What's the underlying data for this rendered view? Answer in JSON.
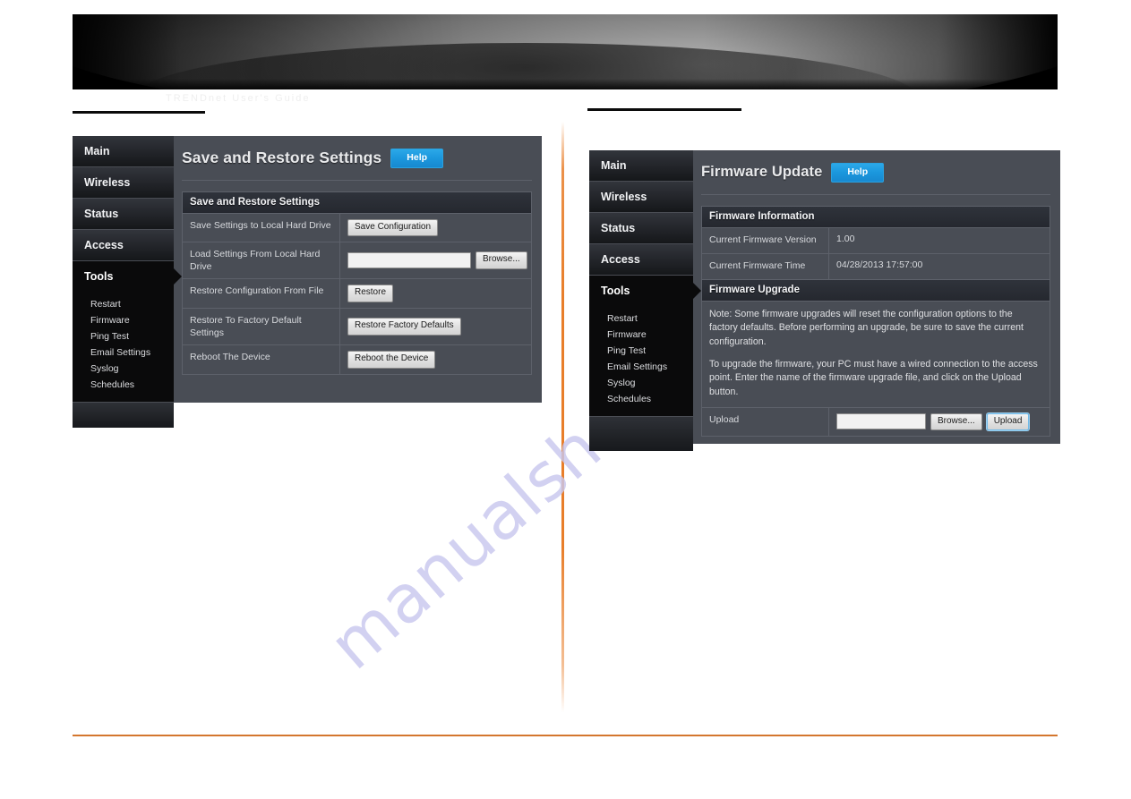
{
  "page": {
    "watermark_text": "manualsh",
    "ghost_text": "TRENDnet  User's Guide"
  },
  "banner": {
    "name": "top-banner-graphic"
  },
  "left_panel": {
    "title": "Save and Restore Settings",
    "help_label": "Help",
    "sidebar": {
      "items": [
        {
          "label": "Main",
          "active": false
        },
        {
          "label": "Wireless",
          "active": false
        },
        {
          "label": "Status",
          "active": false
        },
        {
          "label": "Access",
          "active": false
        },
        {
          "label": "Tools",
          "active": true
        }
      ],
      "sub_items": [
        "Restart",
        "Firmware",
        "Ping Test",
        "Email Settings",
        "Syslog",
        "Schedules"
      ]
    },
    "table": {
      "header": "Save and Restore Settings",
      "rows": [
        {
          "label": "Save Settings to Local Hard Drive",
          "button": "Save Configuration"
        },
        {
          "label": "Load Settings From Local Hard Drive",
          "input_value": "",
          "button": "Browse..."
        },
        {
          "label": "Restore Configuration From File",
          "button": "Restore"
        },
        {
          "label": "Restore To Factory Default Settings",
          "button": "Restore Factory Defaults"
        },
        {
          "label": "Reboot The Device",
          "button": "Reboot the Device"
        }
      ]
    }
  },
  "right_panel": {
    "title": "Firmware Update",
    "help_label": "Help",
    "sidebar": {
      "items": [
        {
          "label": "Main",
          "active": false
        },
        {
          "label": "Wireless",
          "active": false
        },
        {
          "label": "Status",
          "active": false
        },
        {
          "label": "Access",
          "active": false
        },
        {
          "label": "Tools",
          "active": true
        }
      ],
      "sub_items": [
        "Restart",
        "Firmware",
        "Ping Test",
        "Email Settings",
        "Syslog",
        "Schedules"
      ]
    },
    "info_table": {
      "header": "Firmware Information",
      "rows": [
        {
          "label": "Current Firmware Version",
          "value": "1.00"
        },
        {
          "label": "Current Firmware Time",
          "value": "04/28/2013 17:57:00"
        }
      ]
    },
    "upgrade_table": {
      "header": "Firmware Upgrade",
      "note_1": "Note: Some firmware upgrades will reset the configuration options to the factory defaults. Before performing an upgrade, be sure to save the current configuration.",
      "note_2": "To upgrade the firmware, your PC must have a wired connection to the access point. Enter the name of the firmware upgrade file, and click on the Upload button.",
      "upload_label": "Upload",
      "upload_input_value": "",
      "browse_label": "Browse...",
      "upload_button": "Upload"
    }
  },
  "colors": {
    "panel_bg": "#494d55",
    "sidebar_bg": "#17191d",
    "active_nav": "#0a0a0b",
    "help_blue": "#1b97dd",
    "accent_orange": "#d4762e",
    "watermark": "#c9c8ee"
  }
}
